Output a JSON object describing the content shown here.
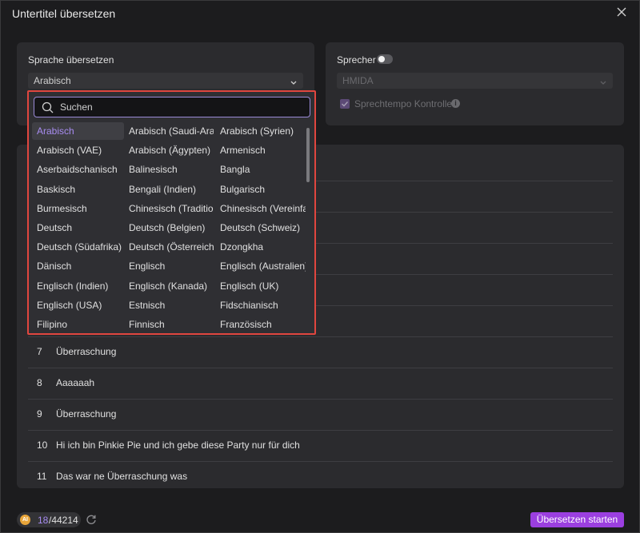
{
  "window": {
    "title": "Untertitel übersetzen",
    "close_icon": "close-icon"
  },
  "translate_section": {
    "label": "Sprache übersetzen",
    "selected_language": "Arabisch"
  },
  "speaker_section": {
    "label": "Sprecher",
    "toggle_on": false,
    "voice_value": "HMIDA",
    "speed_control_label": "Sprechtempo Kontrolle",
    "speed_control_checked": true
  },
  "dropdown": {
    "search_placeholder": "Suchen",
    "search_value": "",
    "languages": [
      [
        "Arabisch",
        "Arabisch (Saudi-Ara...",
        "Arabisch (Syrien)"
      ],
      [
        "Arabisch (VAE)",
        "Arabisch (Ägypten)",
        "Armenisch"
      ],
      [
        "Aserbaidschanisch",
        "Balinesisch",
        "Bangla"
      ],
      [
        "Baskisch",
        "Bengali (Indien)",
        "Bulgarisch"
      ],
      [
        "Burmesisch",
        "Chinesisch (Traditio...",
        "Chinesisch (Vereinfa..."
      ],
      [
        "Deutsch",
        "Deutsch (Belgien)",
        "Deutsch (Schweiz)"
      ],
      [
        "Deutsch (Südafrika)",
        "Deutsch (Österreich)",
        "Dzongkha"
      ],
      [
        "Dänisch",
        "Englisch",
        "Englisch (Australien)"
      ],
      [
        "Englisch (Indien)",
        "Englisch (Kanada)",
        "Englisch (UK)"
      ],
      [
        "Englisch (USA)",
        "Estnisch",
        "Fidschianisch"
      ],
      [
        "Filipino",
        "Finnisch",
        "Französisch"
      ]
    ],
    "selected": "Arabisch"
  },
  "subtitles": [
    {
      "num": "7",
      "text": "Überraschung"
    },
    {
      "num": "8",
      "text": "Aaaaaah"
    },
    {
      "num": "9",
      "text": "Überraschung"
    },
    {
      "num": "10",
      "text": "Hi  ich bin Pinkie Pie und ich gebe diese Party nur für dich"
    },
    {
      "num": "11",
      "text": "Das war ne Überraschung  was"
    }
  ],
  "footer": {
    "credit_icon_text": "AI",
    "credits_used": "18",
    "credits_total": "/44214",
    "start_button": "Übersetzen starten"
  },
  "colors": {
    "accent": "#9b3fe0",
    "highlight_border": "#e0463f",
    "selected_text": "#a78cf0"
  }
}
